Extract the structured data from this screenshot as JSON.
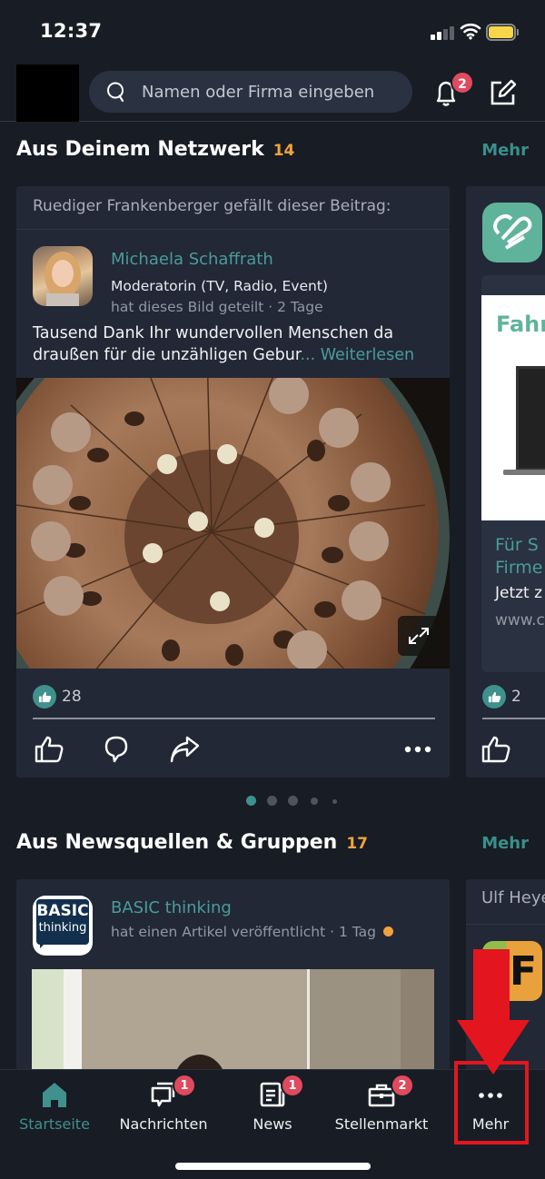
{
  "status_bar": {
    "time": "12:37",
    "signal_bars_on": 2,
    "signal_bars_total": 4,
    "battery_color": "#f7d64a"
  },
  "header": {
    "search_placeholder": "Namen oder Firma eingeben",
    "search_value": "",
    "notifications_badge": "2",
    "icons": [
      "search-icon",
      "bell-icon",
      "compose-icon"
    ]
  },
  "sections": {
    "network": {
      "title": "Aus Deinem Netzwerk",
      "count": "14",
      "more_label": "Mehr"
    },
    "news": {
      "title": "Aus Newsquellen & Gruppen",
      "count": "17",
      "more_label": "Mehr"
    }
  },
  "network_card": {
    "liked_by": "Ruediger Frankenberger gefällt dieser Beitrag:",
    "author": "Michaela Schaffrath",
    "headline": "Moderatorin (TV, Radio, Event)",
    "meta": "hat dieses Bild geteilt · 2 Tage",
    "text": "Tausend Dank Ihr wundervollen Menschen da draußen für die unzähligen Gebur",
    "ellipsis": "...",
    "read_more": "Weiterlesen",
    "image_alt": "Schokoladentorte mit Zahl 50",
    "like_count": "28",
    "actions": [
      "like",
      "comment",
      "share",
      "more"
    ]
  },
  "network_card_2": {
    "ad_title_partial": "Fahr",
    "title_partial_line1": "Für S",
    "title_partial_line2": "Firme",
    "subtitle_partial": "Jetzt z",
    "url_partial": "www.c",
    "like_count": "2"
  },
  "carousel": {
    "total_dots": 5,
    "active_index": 0
  },
  "news_card": {
    "source": "BASIC thinking",
    "logo_line1": "BASIC",
    "logo_line2": "thinking",
    "meta": "hat einen Artikel veröffentlicht · 1 Tag",
    "unread_dot_color": "#f2a33a"
  },
  "news_card_2": {
    "liked_by_partial": "Ulf Heye",
    "logo_letter": "F"
  },
  "bottom_nav": {
    "items": [
      {
        "label": "Startseite",
        "icon": "home-icon",
        "badge": null,
        "active": true
      },
      {
        "label": "Nachrichten",
        "icon": "messages-icon",
        "badge": "1",
        "active": false
      },
      {
        "label": "News",
        "icon": "news-icon",
        "badge": "1",
        "active": false
      },
      {
        "label": "Stellenmarkt",
        "icon": "briefcase-icon",
        "badge": "2",
        "active": false
      },
      {
        "label": "Mehr",
        "icon": "more-icon",
        "badge": null,
        "active": false
      }
    ]
  },
  "colors": {
    "background": "#181c24",
    "card": "#222836",
    "accent_teal": "#3f918d",
    "accent_orange": "#f2a33a",
    "badge_red": "#e04a5f",
    "annotation_red": "#e3161f"
  }
}
